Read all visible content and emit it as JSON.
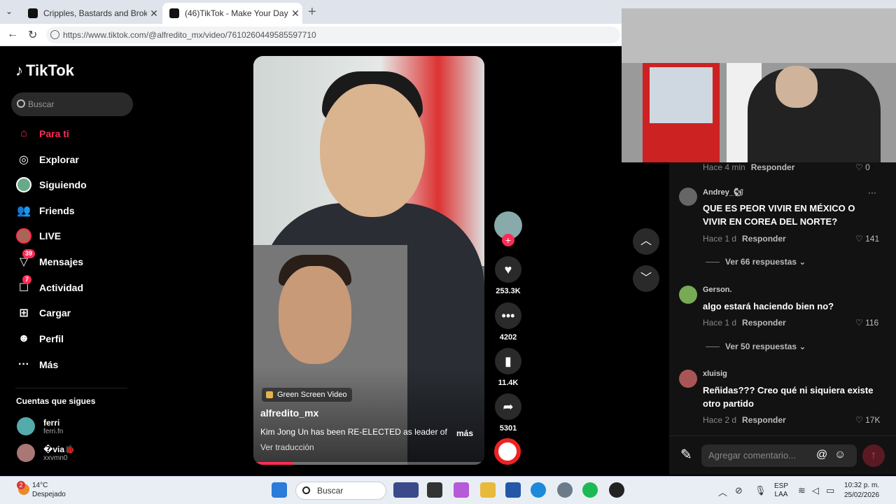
{
  "browser": {
    "tabs": [
      {
        "title": "Cripples, Bastards and Broken Thin",
        "active": false
      },
      {
        "title": "(46)TikTok - Make Your Day",
        "active": true
      }
    ],
    "url": "https://www.tiktok.com/@alfredito_mx/video/7610260449585597710"
  },
  "sidebar": {
    "logo": "TikTok",
    "search_placeholder": "Buscar",
    "items": [
      {
        "label": "Para ti",
        "icon": "home-icon"
      },
      {
        "label": "Explorar",
        "icon": "compass-icon"
      },
      {
        "label": "Siguiendo",
        "icon": "avatar-icon"
      },
      {
        "label": "Friends",
        "icon": "friends-icon"
      },
      {
        "label": "LIVE",
        "icon": "live-icon"
      },
      {
        "label": "Mensajes",
        "icon": "messages-icon",
        "badge": "39"
      },
      {
        "label": "Actividad",
        "icon": "activity-icon",
        "badge": "7"
      },
      {
        "label": "Cargar",
        "icon": "upload-icon"
      },
      {
        "label": "Perfil",
        "icon": "profile-icon"
      },
      {
        "label": "Más",
        "icon": "more-icon"
      }
    ],
    "following_heading": "Cuentas que sigues",
    "following": [
      {
        "name": "ferri",
        "handle": "ferri.fn"
      },
      {
        "name": "�via🐞",
        "handle": "xxvmn0"
      }
    ]
  },
  "video": {
    "tag": "Green Screen Video",
    "author": "alfredito_mx",
    "caption": "Kim Jong Un has been RE-ELECTED as leader of",
    "more": "más",
    "translate": "Ver traducción",
    "progress": 0.17
  },
  "actions": {
    "likes": "253.3K",
    "comments": "4202",
    "saves": "11.4K",
    "shares": "5301"
  },
  "comments": {
    "top_meta": {
      "time": "Hace 4 min",
      "reply": "Responder",
      "likes": "0"
    },
    "items": [
      {
        "user": "Andrey_🐿",
        "text": "QUE ES PEOR VIVIR EN MÉXICO O VIVIR EN COREA DEL NORTE?",
        "time": "Hace 1 d",
        "reply": "Responder",
        "likes": "141",
        "replies": "Ver 66 respuestas"
      },
      {
        "user": "Gerson.",
        "text": "algo estará haciendo bien no?",
        "time": "Hace 1 d",
        "reply": "Responder",
        "likes": "116",
        "replies": "Ver 50 respuestas"
      },
      {
        "user": "xluisig",
        "text": "Reñidas??? Creo qué ni siquiera existe otro partido",
        "time": "Hace 2 d",
        "reply": "Responder",
        "likes": "17K"
      }
    ],
    "input_placeholder": "Agregar comentario..."
  },
  "taskbar": {
    "weather_temp": "14°C",
    "weather_desc": "Despejado",
    "weather_badge": "2",
    "search": "Buscar",
    "lang_top": "ESP",
    "lang_bottom": "LAA",
    "time": "10:32 p. m.",
    "date": "25/02/2026"
  }
}
